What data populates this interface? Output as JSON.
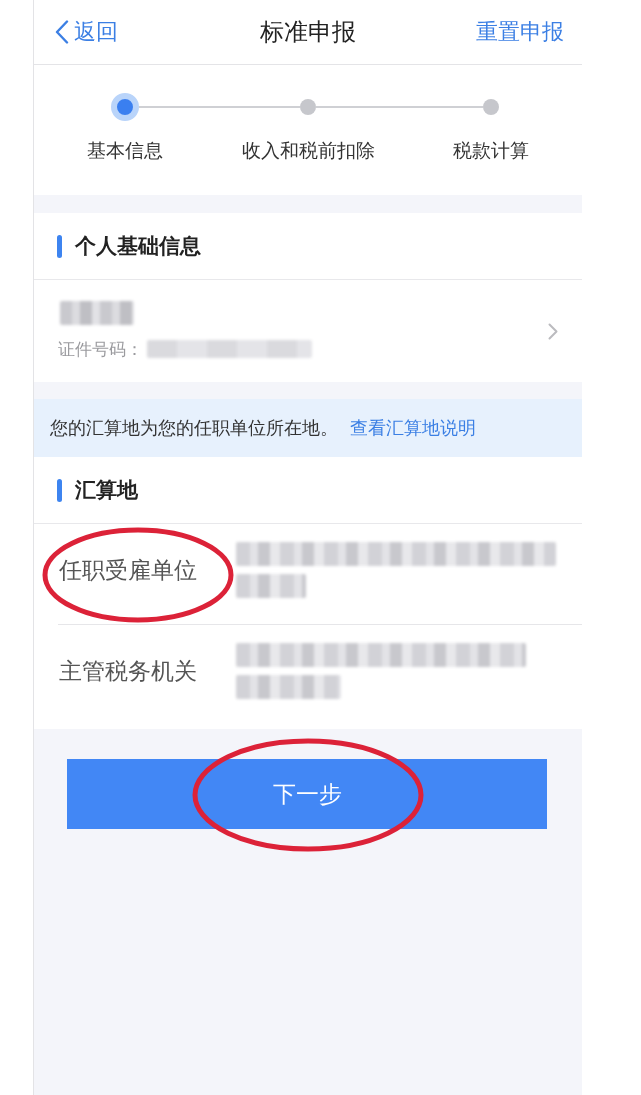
{
  "header": {
    "back": "返回",
    "title": "标准申报",
    "action": "重置申报"
  },
  "steps": [
    {
      "label": "基本信息",
      "selected": true
    },
    {
      "label": "收入和税前扣除",
      "selected": false
    },
    {
      "label": "税款计算",
      "selected": false
    }
  ],
  "personal_section": {
    "title": "个人基础信息",
    "name_blurred": true,
    "id_label": "证件号码：",
    "id_blurred": true
  },
  "notice": {
    "text": "您的汇算地为您的任职单位所在地。",
    "link": "查看汇算地说明"
  },
  "settlement_section": {
    "title": "汇算地",
    "rows": [
      {
        "label": "任职受雇单位",
        "value_blurred": true,
        "circled": true
      },
      {
        "label": "主管税务机关",
        "value_blurred": true,
        "circled": false
      }
    ]
  },
  "next_button": {
    "label": "下一步",
    "circled": true
  }
}
